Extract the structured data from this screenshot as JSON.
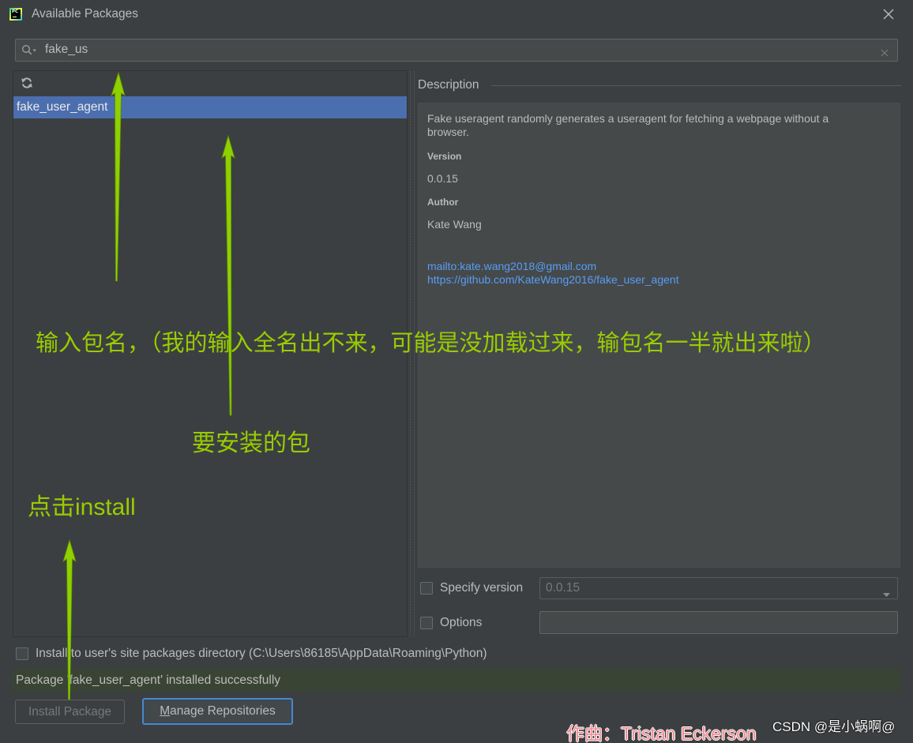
{
  "window": {
    "title": "Available Packages",
    "app_icon_text": "PC"
  },
  "search": {
    "value": "fake_us"
  },
  "package_list": {
    "items": [
      {
        "name": "fake_user_agent",
        "selected": true
      }
    ]
  },
  "description": {
    "label": "Description",
    "summary": "Fake useragent randomly generates a useragent for fetching a webpage without a browser.",
    "version_label": "Version",
    "version": "0.0.15",
    "author_label": "Author",
    "author": "Kate Wang",
    "links": [
      "mailto:kate.wang2018@gmail.com",
      "https://github.com/KateWang2016/fake_user_agent"
    ]
  },
  "settings": {
    "specify_version": {
      "label": "Specify version",
      "checked": false,
      "value": "0.0.15"
    },
    "options": {
      "label": "Options",
      "checked": false,
      "value": ""
    },
    "install_to_user": {
      "label": "Install to user's site packages directory (C:\\Users\\86185\\AppData\\Roaming\\Python)",
      "checked": false
    }
  },
  "status": {
    "message": "Package 'fake_user_agent' installed successfully"
  },
  "buttons": {
    "install_package": {
      "label": "Install Package",
      "enabled": false
    },
    "manage_repositories": {
      "label": "Manage Repositories",
      "focused": true
    }
  },
  "annotations": {
    "search_hint": "输入包名，（我的输入全名出不来，可能是没加载过来，输包名一半就出来啦）",
    "package_hint": "要安装的包",
    "install_hint": "点击install"
  },
  "watermarks": {
    "credit": "作曲：Tristan Eckerson",
    "source": "CSDN @是小蜗啊@"
  },
  "icons": {
    "app": "pycharm-logo-icon",
    "search": "search-icon",
    "clear": "clear-search-icon",
    "close": "close-icon",
    "refresh": "refresh-icon",
    "dropdown": "chevron-down-icon",
    "annotation": "arrow-up-icon"
  },
  "colors": {
    "panel_bg": "#3c3f41",
    "text": "#bbbbbb",
    "accent": "#4b6eaf",
    "link": "#589df6",
    "field_bg": "#45494a",
    "desc_bg": "#45494a",
    "success_bg": "#3a4434",
    "focus": "#4a88c7",
    "annotation": "#99cc00",
    "credit": "#f08c94"
  }
}
